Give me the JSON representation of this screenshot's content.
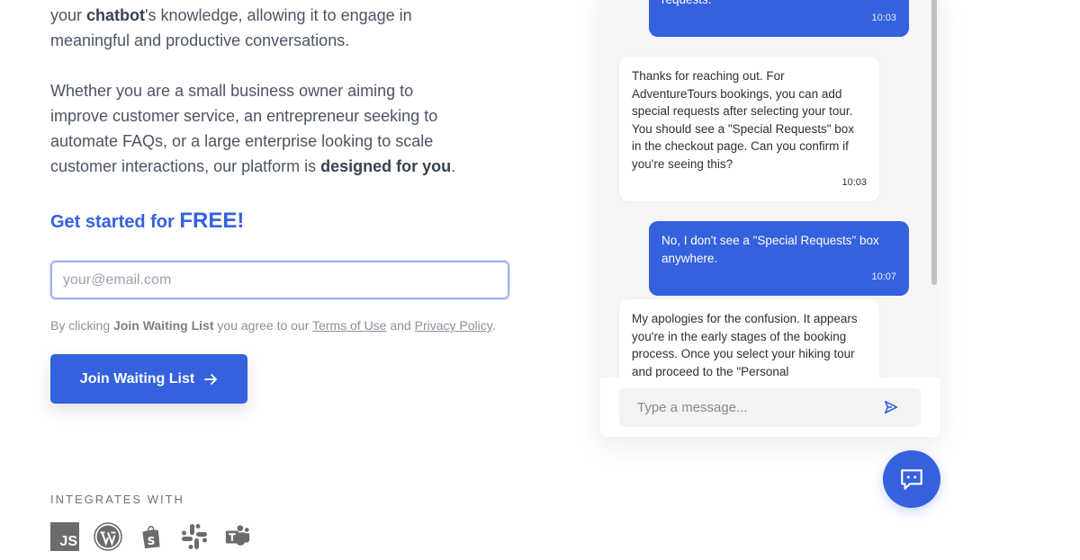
{
  "intro": {
    "p1": {
      "pre": "your ",
      "bold": "chatbot",
      "post": "'s knowledge, allowing it to engage in meaningful and productive conversations."
    },
    "p2": {
      "pre": "Whether you are a small business owner aiming to improve customer service, an entrepreneur seeking to automate FAQs, or a large enterprise looking to scale customer interactions, our platform is ",
      "bold": "designed for you",
      "post": "."
    }
  },
  "signup": {
    "cta_prefix": "Get started for ",
    "cta_emphasis": "FREE!",
    "email_placeholder": "your@email.com",
    "email_value": "",
    "consent": {
      "pre": "By clicking ",
      "bold": "Join Waiting List",
      "mid": " you agree to our ",
      "terms_link": "Terms of Use",
      "and": " and ",
      "privacy_link": "Privacy Policy",
      "end": "."
    },
    "join_button": "Join Waiting List",
    "join_button_icon": "arrow-right-icon"
  },
  "integrations": {
    "label": "INTEGRATES WITH",
    "items": [
      {
        "name": "JavaScript",
        "icon": "javascript-icon",
        "text": "JS"
      },
      {
        "name": "WordPress",
        "icon": "wordpress-icon"
      },
      {
        "name": "Shopify",
        "icon": "shopify-icon"
      },
      {
        "name": "Slack",
        "icon": "slack-icon"
      },
      {
        "name": "Microsoft Teams",
        "icon": "teams-icon"
      }
    ]
  },
  "chat": {
    "messages": [
      {
        "sender": "user",
        "text": "can't find the option to add special dietary requests.",
        "time": "10:03"
      },
      {
        "sender": "bot",
        "text": "Thanks for reaching out. For AdventureTours bookings, you can add special requests after selecting your tour. You should see a \"Special Requests\" box in the checkout page. Can you confirm if you're seeing this?",
        "time": "10:03"
      },
      {
        "sender": "user",
        "text": "No, I don't see a \"Special Requests\" box anywhere.",
        "time": "10:07"
      },
      {
        "sender": "bot",
        "text": "My apologies for the confusion. It appears you're in the early stages of the booking process. Once you select your hiking tour and proceed to the \"Personal",
        "time": ""
      }
    ],
    "input_placeholder": "Type a message...",
    "input_value": "",
    "send_icon": "send-icon",
    "fab_icon": "chat-bubble-icon"
  },
  "colors": {
    "brand": "#3561df",
    "text": "#4b5563",
    "muted": "#8b9099"
  }
}
